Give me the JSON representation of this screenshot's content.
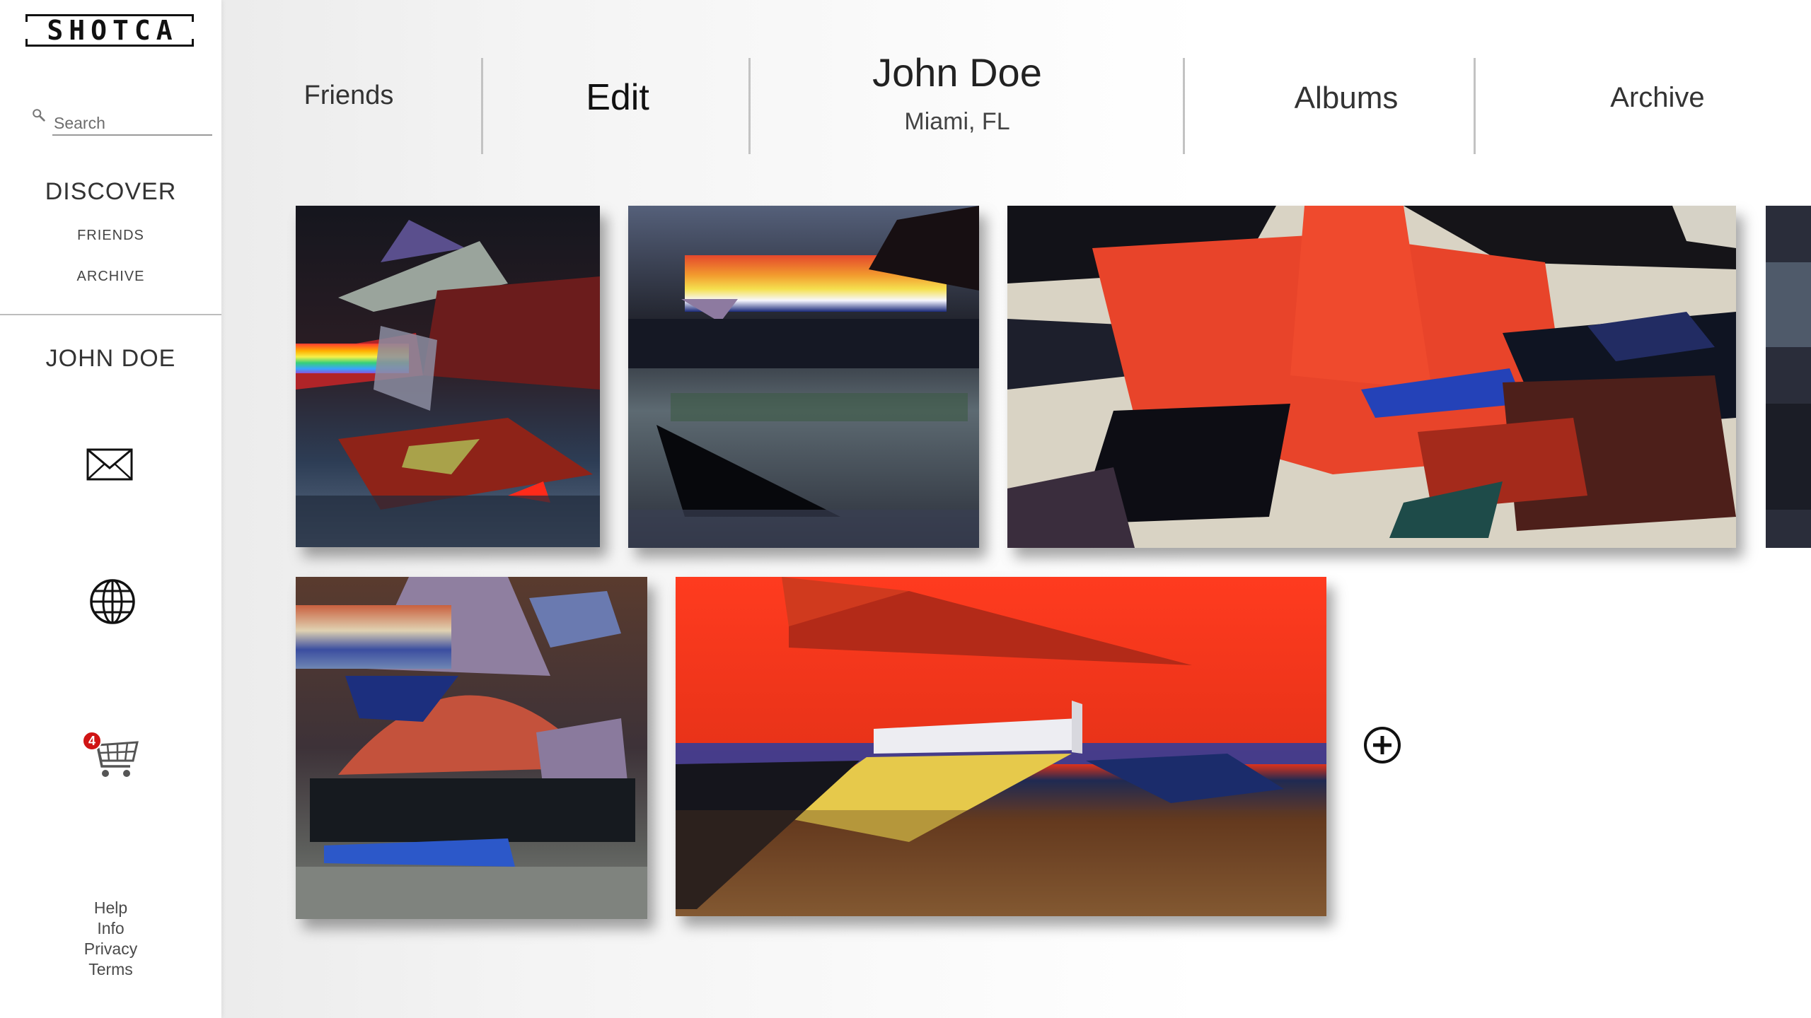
{
  "app": {
    "logo_text": "SHOTCA"
  },
  "sidebar": {
    "search": {
      "placeholder": "Search",
      "value": ""
    },
    "discover_label": "DISCOVER",
    "links": [
      {
        "label": "FRIENDS"
      },
      {
        "label": "ARCHIVE"
      }
    ],
    "user_name": "JOHN DOE",
    "icons": [
      "mail-icon",
      "globe-icon",
      "cart-icon"
    ],
    "cart_count": "4",
    "footer": [
      {
        "label": "Help"
      },
      {
        "label": "Info"
      },
      {
        "label": "Privacy"
      },
      {
        "label": "Terms"
      }
    ]
  },
  "topnav": {
    "friends_label": "Friends",
    "edit_label": "Edit",
    "profile_name": "John Doe",
    "profile_location": "Miami, FL",
    "albums_label": "Albums",
    "archive_label": "Archive"
  },
  "gallery": {
    "artwork_count": 6,
    "add_icon": "plus-circle-icon",
    "colors": {
      "red": "#e23a1f",
      "navy": "#1b2233",
      "canvas": "#d9d3c4",
      "badge": "#d01414"
    }
  }
}
